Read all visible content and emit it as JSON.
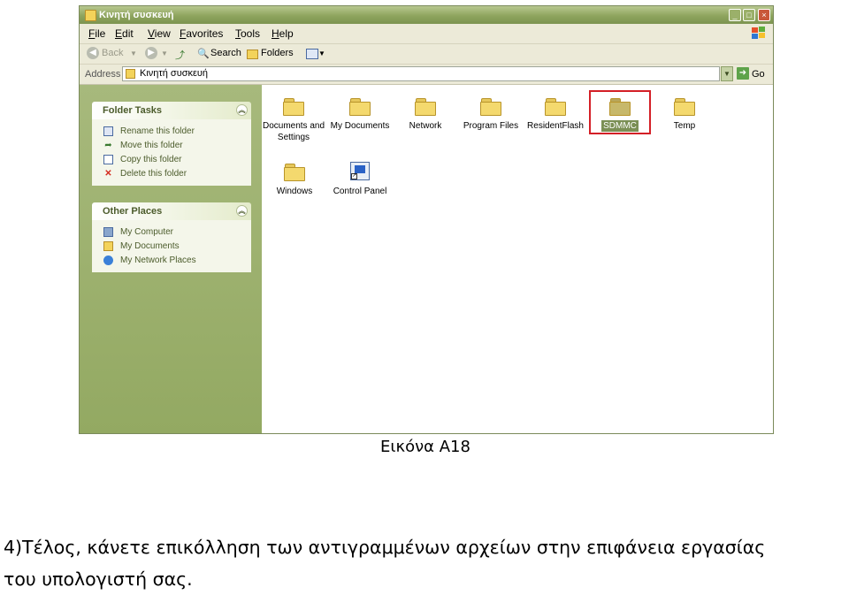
{
  "window": {
    "title": "Κινητή συσκευή",
    "buttons": {
      "minimize": "_",
      "maximize": "□",
      "close": "×"
    }
  },
  "menu": [
    "File",
    "Edit",
    "View",
    "Favorites",
    "Tools",
    "Help"
  ],
  "toolbar": {
    "back_label": "Back",
    "search_label": "Search",
    "folders_label": "Folders"
  },
  "address": {
    "label": "Address",
    "value": "Κινητή συσκευή",
    "go_label": "Go"
  },
  "folder_tasks": {
    "title": "Folder Tasks",
    "items": [
      {
        "label": "Rename this folder",
        "icon": "rename-icon"
      },
      {
        "label": "Move this folder",
        "icon": "move-icon"
      },
      {
        "label": "Copy this folder",
        "icon": "copy-icon"
      },
      {
        "label": "Delete this folder",
        "icon": "delete-icon"
      }
    ]
  },
  "other_places": {
    "title": "Other Places",
    "items": [
      {
        "label": "My Computer",
        "icon": "computer-icon"
      },
      {
        "label": "My Documents",
        "icon": "documents-icon"
      },
      {
        "label": "My Network Places",
        "icon": "network-icon"
      }
    ]
  },
  "files": [
    {
      "label1": "Documents and",
      "label2": "Settings"
    },
    {
      "label1": "My Documents",
      "label2": ""
    },
    {
      "label1": "Network",
      "label2": ""
    },
    {
      "label1": "Program Files",
      "label2": ""
    },
    {
      "label1": "ResidentFlash",
      "label2": ""
    },
    {
      "label1": "SDMMC",
      "label2": "",
      "selected": true
    },
    {
      "label1": "Temp",
      "label2": ""
    },
    {
      "label1": "Windows",
      "label2": ""
    },
    {
      "label1": "Control Panel",
      "label2": ""
    }
  ],
  "colors": {
    "highlight": "#d41f26",
    "xp_green": "#93a962"
  },
  "caption": "Εικόνα A18",
  "instruction": {
    "line1": "4)Τέλος, κάνετε επικόλληση των αντιγραμμένων αρχείων στην επιφάνεια εργασίας",
    "line2": "του υπολογιστή σας."
  }
}
